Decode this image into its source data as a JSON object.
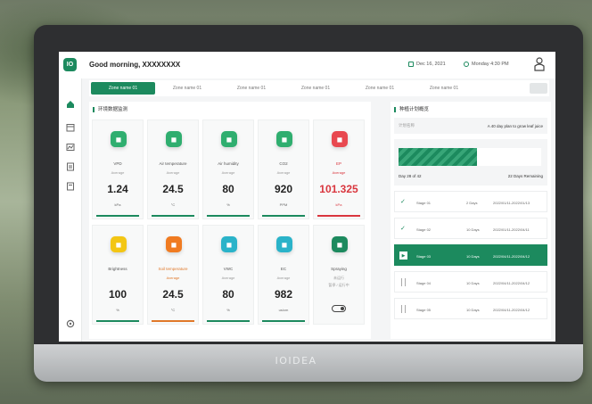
{
  "brand": "IOIDEA",
  "header": {
    "logo_text": "IO",
    "greeting": "Good morning, XXXXXXXX",
    "date": "Dec 16, 2021",
    "time": "Monday 4:30 PM"
  },
  "tabs": [
    {
      "label": "Zone name 01",
      "active": true
    },
    {
      "label": "Zone name 01",
      "active": false
    },
    {
      "label": "Zone name 01",
      "active": false
    },
    {
      "label": "Zone name 01",
      "active": false
    },
    {
      "label": "Zone name 01",
      "active": false
    },
    {
      "label": "Zone name 01",
      "active": false
    }
  ],
  "monitor": {
    "title": "环境数据监测",
    "cards": [
      {
        "name": "VPD",
        "sub": "Average",
        "value": "1.24",
        "unit": "kPa",
        "color": "#2fae6f",
        "icon": "leaf-icon"
      },
      {
        "name": "Air temperature",
        "sub": "Average",
        "value": "24.5",
        "unit": "°C",
        "color": "#2fae6f",
        "icon": "thermometer-icon"
      },
      {
        "name": "Air humidity",
        "sub": "Average",
        "value": "80",
        "unit": "%",
        "color": "#2fae6f",
        "icon": "droplet-icon"
      },
      {
        "name": "CO2",
        "sub": "Average",
        "value": "920",
        "unit": "PPM",
        "color": "#2fae6f",
        "icon": "cloud-icon"
      },
      {
        "name": "EP",
        "sub": "Average",
        "value": "101.325",
        "unit": "kPa",
        "color": "#e8484f",
        "icon": "pressure-icon",
        "alert": true
      },
      {
        "name": "Brightness",
        "sub": "",
        "value": "100",
        "unit": "%",
        "color": "#f3c614",
        "icon": "sun-icon"
      },
      {
        "name": "Soil temperature",
        "sub": "Average",
        "value": "24.5",
        "unit": "°C",
        "color": "#f07b21",
        "icon": "soil-thermometer-icon",
        "warn": true
      },
      {
        "name": "VWC",
        "sub": "Average",
        "value": "80",
        "unit": "%",
        "color": "#2ab3c9",
        "icon": "water-icon"
      },
      {
        "name": "EC",
        "sub": "Average",
        "value": "982",
        "unit": "us/cm",
        "color": "#2ab3c9",
        "icon": "ec-icon"
      },
      {
        "name": "Spraying",
        "sub": "未运行",
        "value": "",
        "unit": "",
        "color": "#1c8a5e",
        "icon": "spray-icon",
        "toggle": true,
        "sub2": "暂停 / 运行中"
      }
    ]
  },
  "plan": {
    "title": "种植计划概览",
    "label": "计划名称",
    "description": "A 40 day plan to grow leaf juice",
    "progress": 0.55,
    "day_text": "Day 28 of 42",
    "remaining_text": "22 Days Remaining",
    "stages": [
      {
        "name": "Stage 01",
        "duration": "2 Days",
        "dates": "2022/01/11-2022/01/13",
        "status": "done"
      },
      {
        "name": "Stage 02",
        "duration": "10 Days",
        "dates": "2022/01/11-2022/04/11",
        "status": "done"
      },
      {
        "name": "Stage 03",
        "duration": "10 Days",
        "dates": "2022/04/11-2022/04/12",
        "status": "active"
      },
      {
        "name": "Stage 04",
        "duration": "10 Days",
        "dates": "2022/04/11-2022/04/12",
        "status": "pending"
      },
      {
        "name": "Stage 05",
        "duration": "10 Days",
        "dates": "2022/04/11-2022/04/12",
        "status": "pending"
      }
    ]
  }
}
